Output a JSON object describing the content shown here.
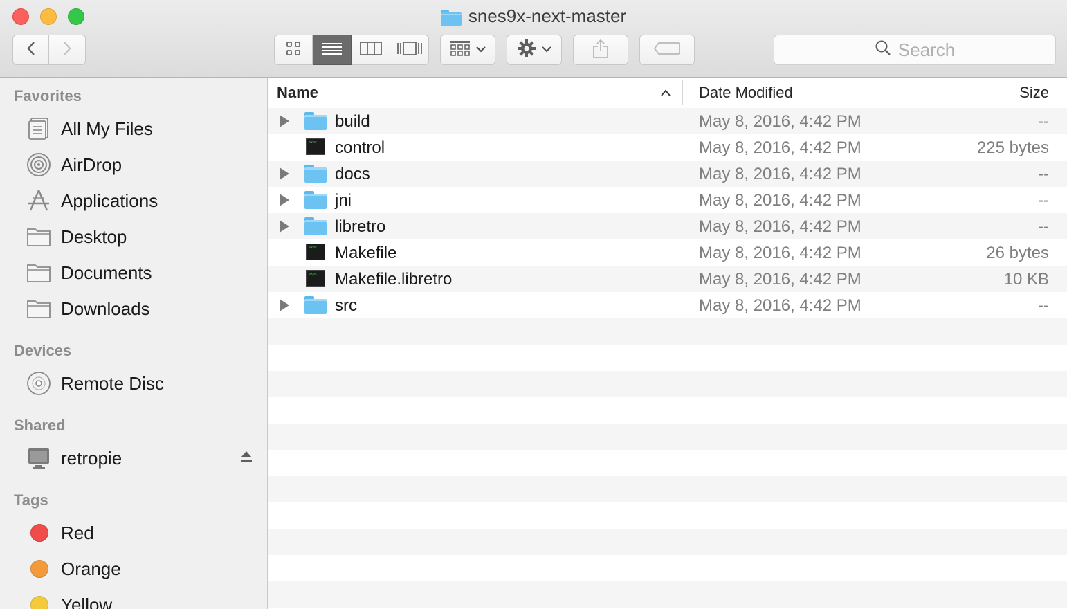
{
  "window": {
    "title": "snes9x-next-master",
    "title_icon": "folder-icon"
  },
  "toolbar": {
    "back_icon": "chevron-left-icon",
    "forward_icon": "chevron-right-icon",
    "view_modes": [
      {
        "name": "icon-view",
        "icon": "grid-icon",
        "active": false
      },
      {
        "name": "list-view",
        "icon": "list-icon",
        "active": true
      },
      {
        "name": "column-view",
        "icon": "columns-icon",
        "active": false
      },
      {
        "name": "cover-flow-view",
        "icon": "coverflow-icon",
        "active": false
      }
    ],
    "arrange_icon": "arrange-grid-icon",
    "action_icon": "gear-icon",
    "share_icon": "share-icon",
    "tag_icon": "tag-icon",
    "search_placeholder": "Search"
  },
  "sidebar": {
    "favorites_header": "Favorites",
    "favorites": [
      {
        "label": "All My Files",
        "icon": "all-files-icon"
      },
      {
        "label": "AirDrop",
        "icon": "airdrop-icon"
      },
      {
        "label": "Applications",
        "icon": "applications-icon"
      },
      {
        "label": "Desktop",
        "icon": "folder-icon"
      },
      {
        "label": "Documents",
        "icon": "folder-icon"
      },
      {
        "label": "Downloads",
        "icon": "folder-icon"
      }
    ],
    "devices_header": "Devices",
    "devices": [
      {
        "label": "Remote Disc",
        "icon": "disc-icon"
      }
    ],
    "shared_header": "Shared",
    "shared": [
      {
        "label": "retropie",
        "icon": "monitor-icon",
        "eject_icon": "eject-icon"
      }
    ],
    "tags_header": "Tags",
    "tags": [
      {
        "label": "Red",
        "color": "#f14c4c"
      },
      {
        "label": "Orange",
        "color": "#f39a3a"
      },
      {
        "label": "Yellow",
        "color": "#f5c93c"
      }
    ]
  },
  "columns": {
    "name": "Name",
    "date": "Date Modified",
    "size": "Size",
    "sort_icon": "chevron-up-icon"
  },
  "files": [
    {
      "name": "build",
      "kind": "folder",
      "date": "May 8, 2016, 4:42 PM",
      "size": "--"
    },
    {
      "name": "control",
      "kind": "exec",
      "date": "May 8, 2016, 4:42 PM",
      "size": "225 bytes"
    },
    {
      "name": "docs",
      "kind": "folder",
      "date": "May 8, 2016, 4:42 PM",
      "size": "--"
    },
    {
      "name": "jni",
      "kind": "folder",
      "date": "May 8, 2016, 4:42 PM",
      "size": "--"
    },
    {
      "name": "libretro",
      "kind": "folder",
      "date": "May 8, 2016, 4:42 PM",
      "size": "--"
    },
    {
      "name": "Makefile",
      "kind": "exec",
      "date": "May 8, 2016, 4:42 PM",
      "size": "26 bytes"
    },
    {
      "name": "Makefile.libretro",
      "kind": "exec",
      "date": "May 8, 2016, 4:42 PM",
      "size": "10 KB"
    },
    {
      "name": "src",
      "kind": "folder",
      "date": "May 8, 2016, 4:42 PM",
      "size": "--"
    }
  ]
}
